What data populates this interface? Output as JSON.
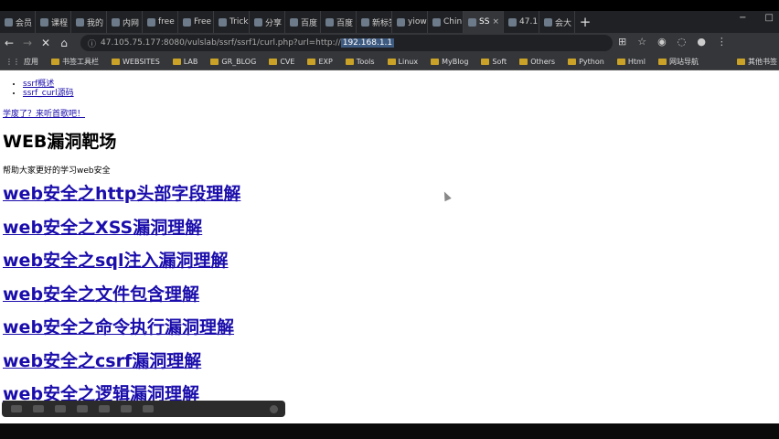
{
  "tabs": [
    {
      "label": "会员"
    },
    {
      "label": "课程"
    },
    {
      "label": "我的"
    },
    {
      "label": "内网"
    },
    {
      "label": "free"
    },
    {
      "label": "Free"
    },
    {
      "label": "Trick"
    },
    {
      "label": "分享"
    },
    {
      "label": "百度"
    },
    {
      "label": "百度"
    },
    {
      "label": "新标签页"
    },
    {
      "label": "yiow"
    },
    {
      "label": "Chin"
    },
    {
      "label": "SS"
    },
    {
      "label": "47.1"
    },
    {
      "label": "会大"
    }
  ],
  "active_tab_close": "×",
  "new_tab": "+",
  "window_controls": {
    "minimize": "−",
    "maximize": "□"
  },
  "address": {
    "prefix": "47.105.75.177:8080/vulslab/ssrf/ssrf1/curl.php?url=http://",
    "selected": "192.168.1.1"
  },
  "bookmarks": {
    "apps_label": "应用",
    "items": [
      "书签工具栏",
      "WEBSITES",
      "LAB",
      "GR_BLOG",
      "CVE",
      "EXP",
      "Tools",
      "Linux",
      "MyBlog",
      "Soft",
      "Others",
      "Python",
      "Html",
      "网站导航"
    ],
    "other": "其他书签"
  },
  "page": {
    "list_items": [
      "ssrf概述",
      "ssrf_curl源码"
    ],
    "learned_link": "学废了？来听首歌吧！",
    "title": "WEB漏洞靶场",
    "description": "帮助大家更好的学习web安全",
    "articles": [
      "web安全之http头部字段理解",
      "web安全之XSS漏洞理解",
      "web安全之sql注入漏洞理解",
      "web安全之文件包含理解",
      "web安全之命令执行漏洞理解",
      "web安全之csrf漏洞理解",
      "web安全之逻辑漏洞理解"
    ]
  }
}
